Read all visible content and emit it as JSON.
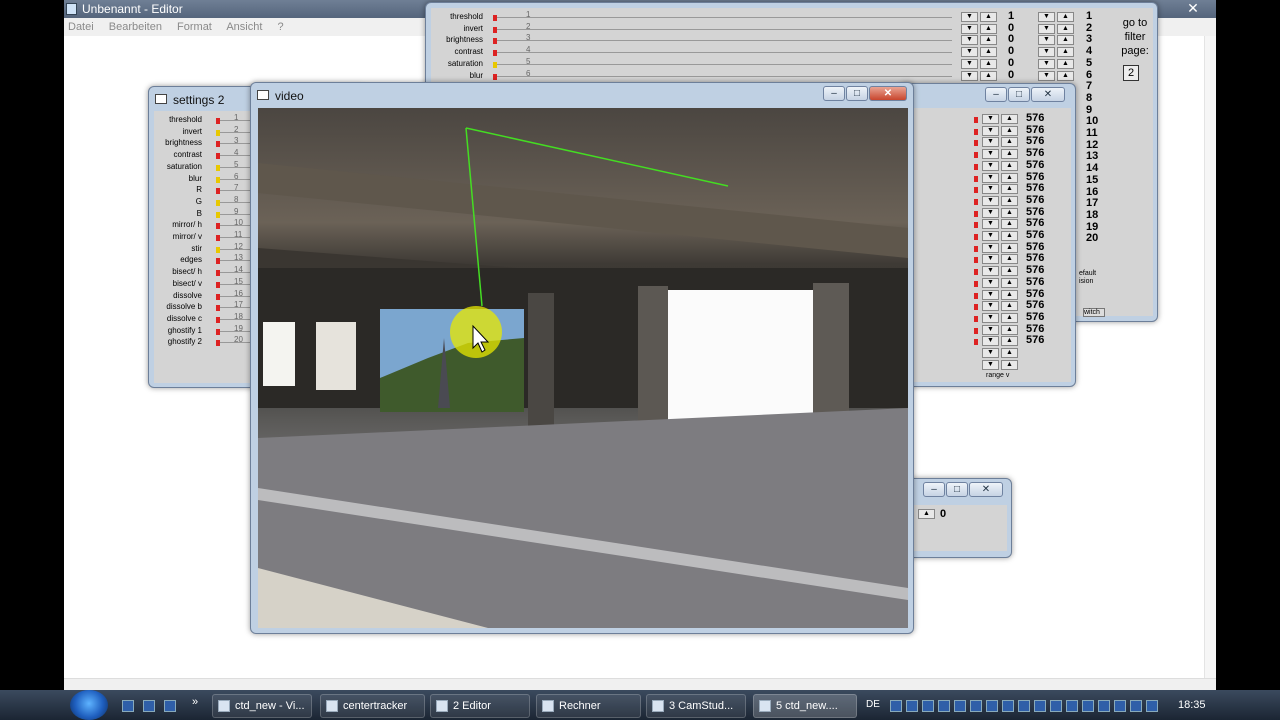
{
  "notepad": {
    "title": "Unbenannt - Editor",
    "menu": [
      "Datei",
      "Bearbeiten",
      "Format",
      "Ansicht",
      "?"
    ],
    "close": "✕"
  },
  "filters": {
    "labels": [
      "threshold",
      "invert",
      "brightness",
      "contrast",
      "saturation",
      "blur",
      "R",
      "G",
      "B",
      "mirror/ h",
      "mirror/ v",
      "stir",
      "edges",
      "bisect/ h",
      "bisect/ v",
      "dissolve",
      "dissolve b",
      "dissolve c",
      "ghostify 1",
      "ghostify 2"
    ],
    "short_labels": [
      "threshold",
      "invert",
      "brightness",
      "contrast",
      "saturation",
      "blur"
    ],
    "row_numbers": [
      "1",
      "2",
      "3",
      "4",
      "5",
      "6",
      "7",
      "8",
      "9",
      "10",
      "11",
      "12",
      "13",
      "14",
      "15",
      "16",
      "17",
      "18",
      "19",
      "20"
    ]
  },
  "main_panel": {
    "values": [
      "1",
      "0",
      "0",
      "0",
      "0",
      "0"
    ],
    "page_numbers": [
      "1",
      "2",
      "3",
      "4",
      "5",
      "6",
      "7",
      "8",
      "9",
      "10",
      "11",
      "12",
      "13",
      "14",
      "15",
      "16",
      "17",
      "18",
      "19",
      "20"
    ],
    "go_to_filter": "go to filter page:",
    "page_box": "2"
  },
  "settings2": {
    "title": "settings 2"
  },
  "right_panel": {
    "values": [
      "576",
      "576",
      "576",
      "576",
      "576",
      "576",
      "576",
      "576",
      "576",
      "576",
      "576",
      "576",
      "576",
      "576",
      "576",
      "576",
      "576",
      "576",
      "576",
      "576"
    ],
    "range_label": "range v",
    "default_label": "efault ision",
    "switch_label": "witch"
  },
  "small_window": {
    "value": "0"
  },
  "video": {
    "title": "video"
  },
  "taskbar": {
    "items": [
      {
        "label": "ctd_new - Vi..."
      },
      {
        "label": "centertracker"
      },
      {
        "label": "2 Editor"
      },
      {
        "label": "Rechner"
      },
      {
        "label": "3 CamStud..."
      },
      {
        "label": "5 ctd_new...."
      }
    ],
    "lang": "DE",
    "clock": "18:35"
  },
  "colors": {
    "accent_green": "#44dd22",
    "cursor_highlight": "#e8e800"
  }
}
